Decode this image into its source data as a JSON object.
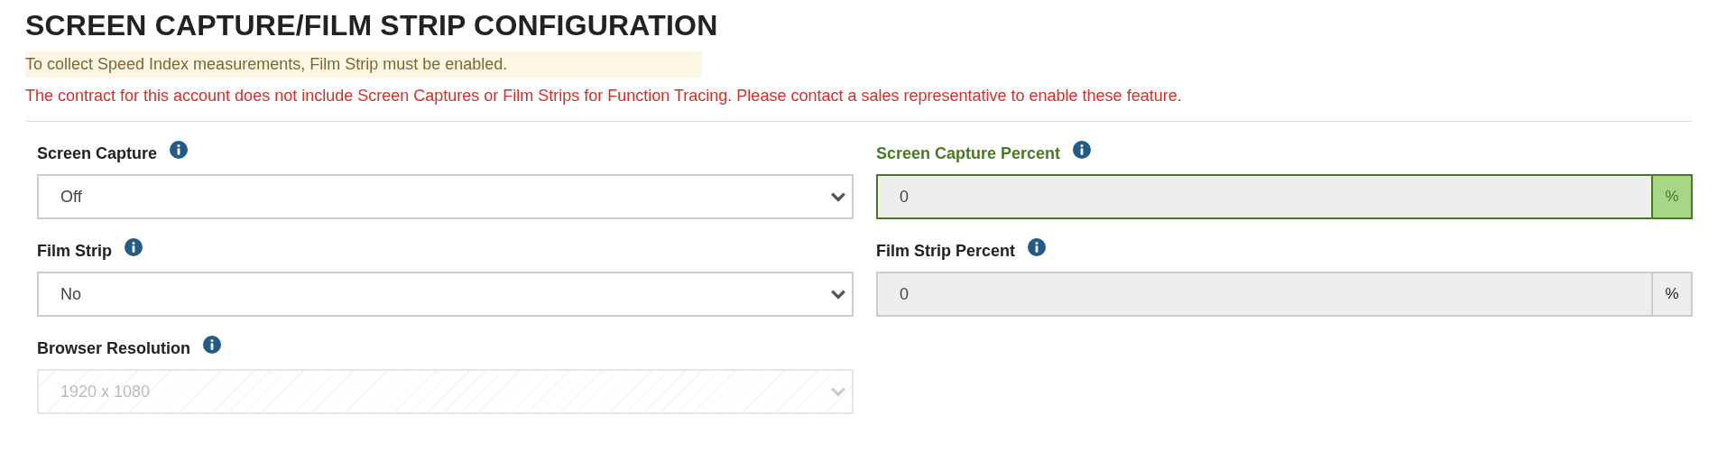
{
  "title": "SCREEN CAPTURE/FILM STRIP CONFIGURATION",
  "notice": "To collect Speed Index measurements, Film Strip must be enabled.",
  "error": "The contract for this account does not include Screen Captures or Film Strips for Function Tracing. Please contact a sales representative to enable these feature.",
  "left_fields": [
    {
      "label": "Screen Capture",
      "value": "Off",
      "disabled": false
    },
    {
      "label": "Film Strip",
      "value": "No",
      "disabled": false
    },
    {
      "label": "Browser Resolution",
      "value": "1920 x 1080",
      "disabled": true
    }
  ],
  "right_fields": [
    {
      "label": "Screen Capture Percent",
      "value": "0",
      "unit": "%",
      "valid": true
    },
    {
      "label": "Film Strip Percent",
      "value": "0",
      "unit": "%",
      "valid": false
    }
  ]
}
